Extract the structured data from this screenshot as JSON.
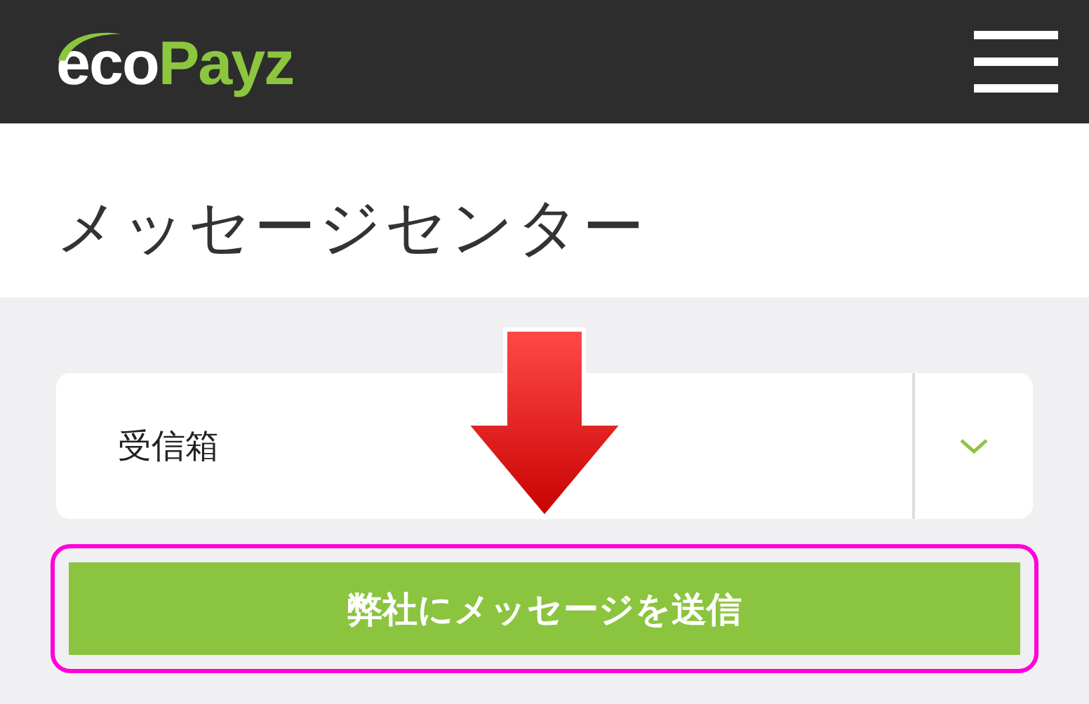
{
  "header": {
    "logo": {
      "part_1": "eco",
      "part_2": "Payz"
    }
  },
  "title": "メッセージセンター",
  "folder_select": {
    "value": "受信箱"
  },
  "send_button": {
    "label": "弊社にメッセージを送信",
    "highlighted": true
  },
  "annotation_arrow": true
}
